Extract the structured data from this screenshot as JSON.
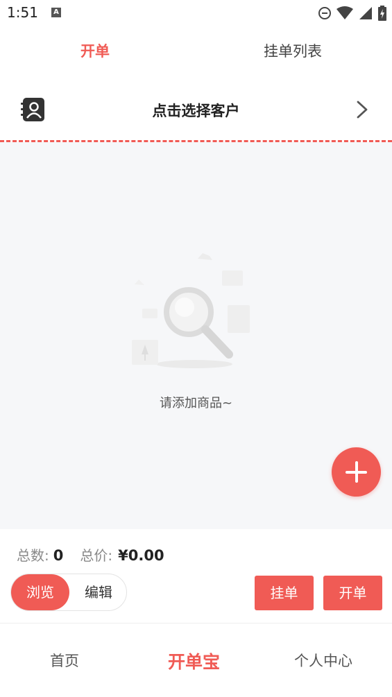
{
  "status_bar": {
    "time": "1:51",
    "a_badge": "A"
  },
  "top_tabs": {
    "active": "开单",
    "inactive": "挂单列表"
  },
  "customer": {
    "label": "点击选择客户"
  },
  "empty_state": {
    "text": "请添加商品~"
  },
  "totals": {
    "count_label": "总数:",
    "count_value": "0",
    "price_label": "总价:",
    "price_value": "¥0.00"
  },
  "mode_toggle": {
    "browse": "浏览",
    "edit": "编辑"
  },
  "actions": {
    "hold": "挂单",
    "create": "开单"
  },
  "bottom_nav": {
    "home": "首页",
    "app": "开单宝",
    "profile": "个人中心"
  },
  "colors": {
    "accent": "#f05b55",
    "background": "#f6f7f9"
  }
}
